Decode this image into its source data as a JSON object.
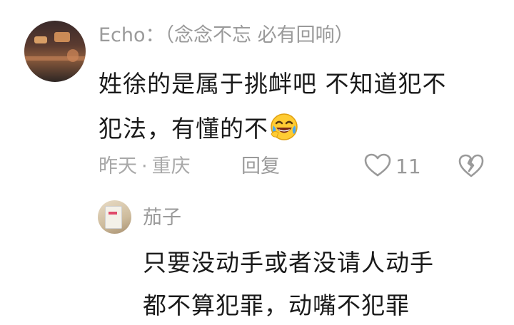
{
  "comment": {
    "username": "Echo：（念念不忘 必有回响）",
    "text_line1": "姓徐的是属于挑衅吧 不知道犯不",
    "text_line2": "犯法，有懂的不",
    "time": "昨天",
    "separator": "·",
    "location": "重庆",
    "reply_label": "回复",
    "like_count": "11",
    "emoji": "laughing-crying-emoji"
  },
  "reply": {
    "username": "茄子",
    "text_line1": "只要没动手或者没请人动手",
    "text_line2": "都不算犯罪，动嘴不犯罪"
  },
  "icons": {
    "like": "heart-outline-icon",
    "dislike": "broken-heart-icon"
  },
  "colors": {
    "meta_text": "#a8a8a8",
    "body_text": "#1a1a1a",
    "username_text": "#9a9a9a"
  }
}
